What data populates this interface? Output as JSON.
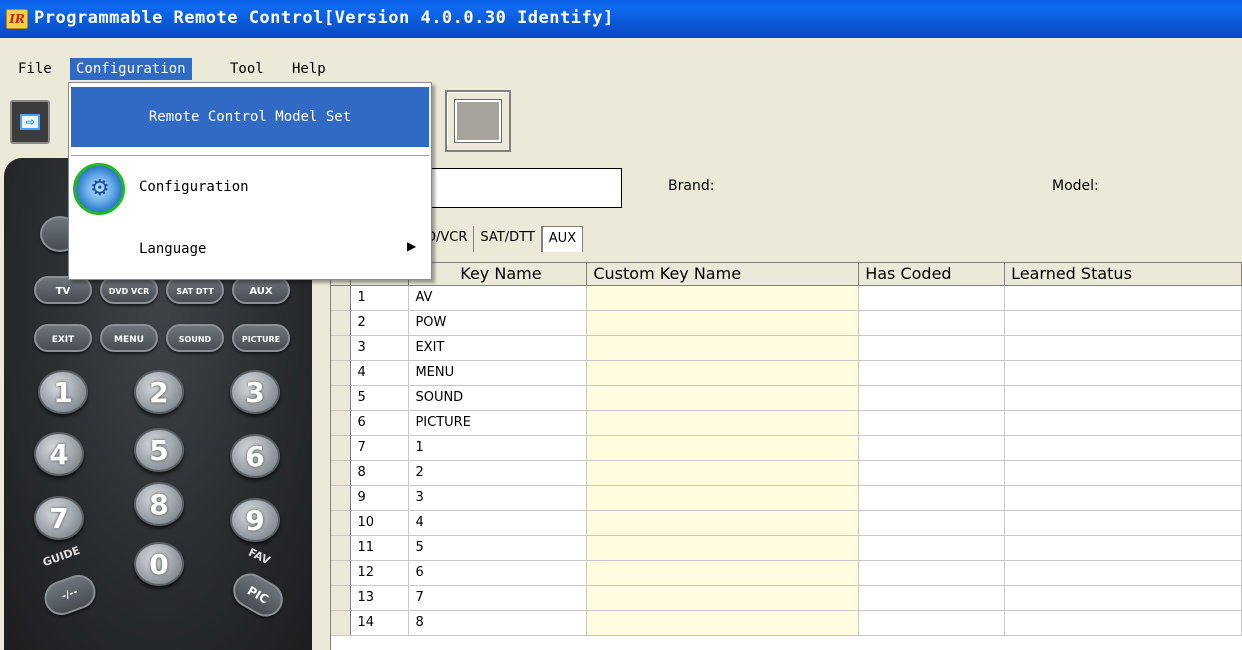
{
  "window": {
    "title": "Programmable Remote Control[Version 4.0.0.30 Identify]",
    "icon_text": "IR"
  },
  "menubar": {
    "file": "File",
    "configuration": "Configuration",
    "tool": "Tool",
    "help": "Help"
  },
  "dropdown": {
    "remote_control_model_set": "Remote Control Model Set",
    "configuration": "Configuration",
    "language": "Language",
    "submenu_arrow": "▶"
  },
  "toolbar": {
    "arrow_glyph": "⇨"
  },
  "form": {
    "brand_label": "Brand:",
    "model_label": "Model:"
  },
  "tabs": [
    "D/VCR",
    "SAT/DTT",
    "AUX"
  ],
  "grid": {
    "columns": [
      "Key Name",
      "Custom Key Name",
      "Has Coded",
      "Learned Status"
    ],
    "rows": [
      {
        "num": "1",
        "key": "AV"
      },
      {
        "num": "2",
        "key": "POW"
      },
      {
        "num": "3",
        "key": "EXIT"
      },
      {
        "num": "4",
        "key": "MENU"
      },
      {
        "num": "5",
        "key": "SOUND"
      },
      {
        "num": "6",
        "key": "PICTURE"
      },
      {
        "num": "7",
        "key": "1"
      },
      {
        "num": "8",
        "key": "2"
      },
      {
        "num": "9",
        "key": "3"
      },
      {
        "num": "10",
        "key": "4"
      },
      {
        "num": "11",
        "key": "5"
      },
      {
        "num": "12",
        "key": "6"
      },
      {
        "num": "13",
        "key": "7"
      },
      {
        "num": "14",
        "key": "8"
      }
    ]
  },
  "remote": {
    "row1": [
      "TV",
      "DVD VCR",
      "SAT DTT",
      "AUX"
    ],
    "row2": [
      "EXIT",
      "MENU",
      "SOUND",
      "PICTURE"
    ],
    "numbers": [
      "1",
      "2",
      "3",
      "4",
      "5",
      "6",
      "7",
      "8",
      "9",
      "0"
    ],
    "guide_label": "GUIDE",
    "fav_label": "FAV",
    "dash_button": "-/--",
    "pic_button": "PIC"
  },
  "colors": {
    "titlebar": "#0a5fe6",
    "menu_highlight": "#316ac5",
    "custom_column": "#fffce0"
  }
}
